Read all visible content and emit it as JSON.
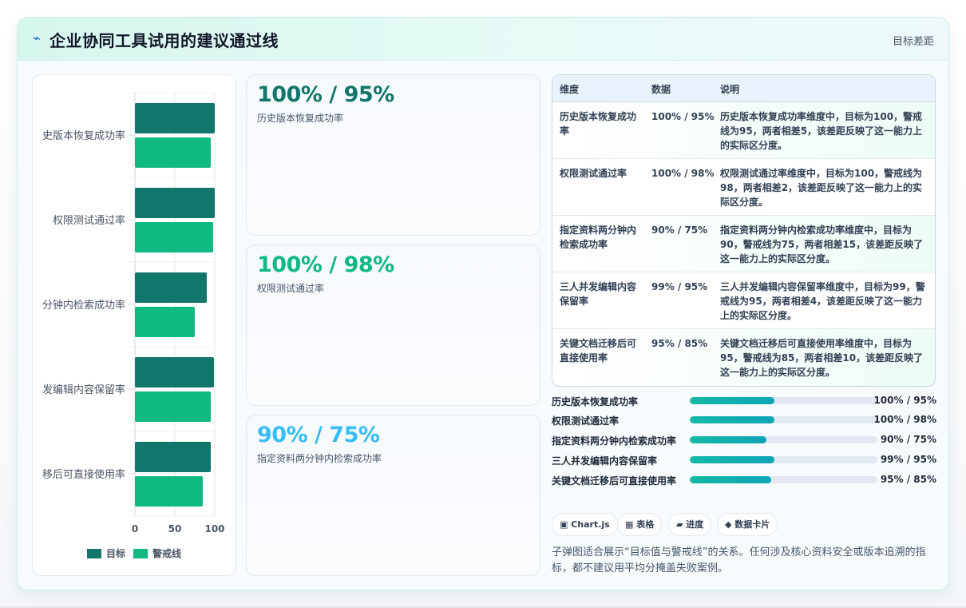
{
  "header": {
    "icon": "lightning-icon",
    "title": "企业协同工具试用的建议通过线",
    "right_label": "目标差距"
  },
  "colors": {
    "target": "#12766b",
    "warning": "#10b981",
    "kpi1": "#12766b",
    "kpi2": "#10b981",
    "kpi3": "#38bdf8"
  },
  "chart_data": {
    "type": "bar",
    "orientation": "horizontal",
    "categories": [
      "史版本恢复成功率",
      "权限测试通过率",
      "分钟内检索成功率",
      "发编辑内容保留率",
      "移后可直接使用率"
    ],
    "series": [
      {
        "name": "目标",
        "values": [
          100,
          100,
          90,
          99,
          95
        ]
      },
      {
        "name": "警戒线",
        "values": [
          95,
          98,
          75,
          95,
          85
        ]
      }
    ],
    "xlim": [
      0,
      100
    ],
    "xticks": [
      "0",
      "50",
      "100"
    ],
    "grid": true,
    "legend_position": "bottom"
  },
  "kpis": [
    {
      "value": "100% / 95%",
      "label": "历史版本恢复成功率"
    },
    {
      "value": "100% / 98%",
      "label": "权限测试通过率"
    },
    {
      "value": "90% / 75%",
      "label": "指定资料两分钟内检索成功率"
    }
  ],
  "table": {
    "headers": [
      "维度",
      "数据",
      "说明"
    ],
    "rows": [
      {
        "dim": "历史版本恢复成功率",
        "data": "100% / 95%",
        "desc": "历史版本恢复成功率维度中，目标为100，警戒线为95，两者相差5，该差距反映了这一能力上的实际区分度。"
      },
      {
        "dim": "权限测试通过率",
        "data": "100% / 98%",
        "desc": "权限测试通过率维度中，目标为100，警戒线为98，两者相差2，该差距反映了这一能力上的实际区分度。"
      },
      {
        "dim": "指定资料两分钟内检索成功率",
        "data": "90% / 75%",
        "desc": "指定资料两分钟内检索成功率维度中，目标为90，警戒线为75，两者相差15，该差距反映了这一能力上的实际区分度。"
      },
      {
        "dim": "三人并发编辑内容保留率",
        "data": "99% / 95%",
        "desc": "三人并发编辑内容保留率维度中，目标为99，警戒线为95，两者相差4，该差距反映了这一能力上的实际区分度。"
      },
      {
        "dim": "关键文档迁移后可直接使用率",
        "data": "95% / 85%",
        "desc": "关键文档迁移后可直接使用率维度中，目标为95，警戒线为85，两者相差10，该差距反映了这一能力上的实际区分度。"
      }
    ]
  },
  "progress": [
    {
      "label": "历史版本恢复成功率",
      "value": "100% / 95%",
      "fill": 0.45
    },
    {
      "label": "权限测试通过率",
      "value": "100% / 98%",
      "fill": 0.45
    },
    {
      "label": "指定资料两分钟内检索成功率",
      "value": "90% / 75%",
      "fill": 0.41
    },
    {
      "label": "三人并发编辑内容保留率",
      "value": "99% / 95%",
      "fill": 0.45
    },
    {
      "label": "关键文档迁移后可直接使用率",
      "value": "95% / 85%",
      "fill": 0.435
    }
  ],
  "pills": [
    {
      "icon": "chart-icon",
      "label": "▣ Chart.js"
    },
    {
      "icon": "table-icon",
      "label": "▦ 表格"
    },
    {
      "icon": "progress-icon",
      "label": "▰ 进度"
    },
    {
      "icon": "card-icon",
      "label": "◆ 数据卡片"
    }
  ],
  "note": "子弹图适合展示“目标值与警戒线”的关系。任何涉及核心资料安全或版本追溯的指标，都不建议用平均分掩盖失败案例。"
}
